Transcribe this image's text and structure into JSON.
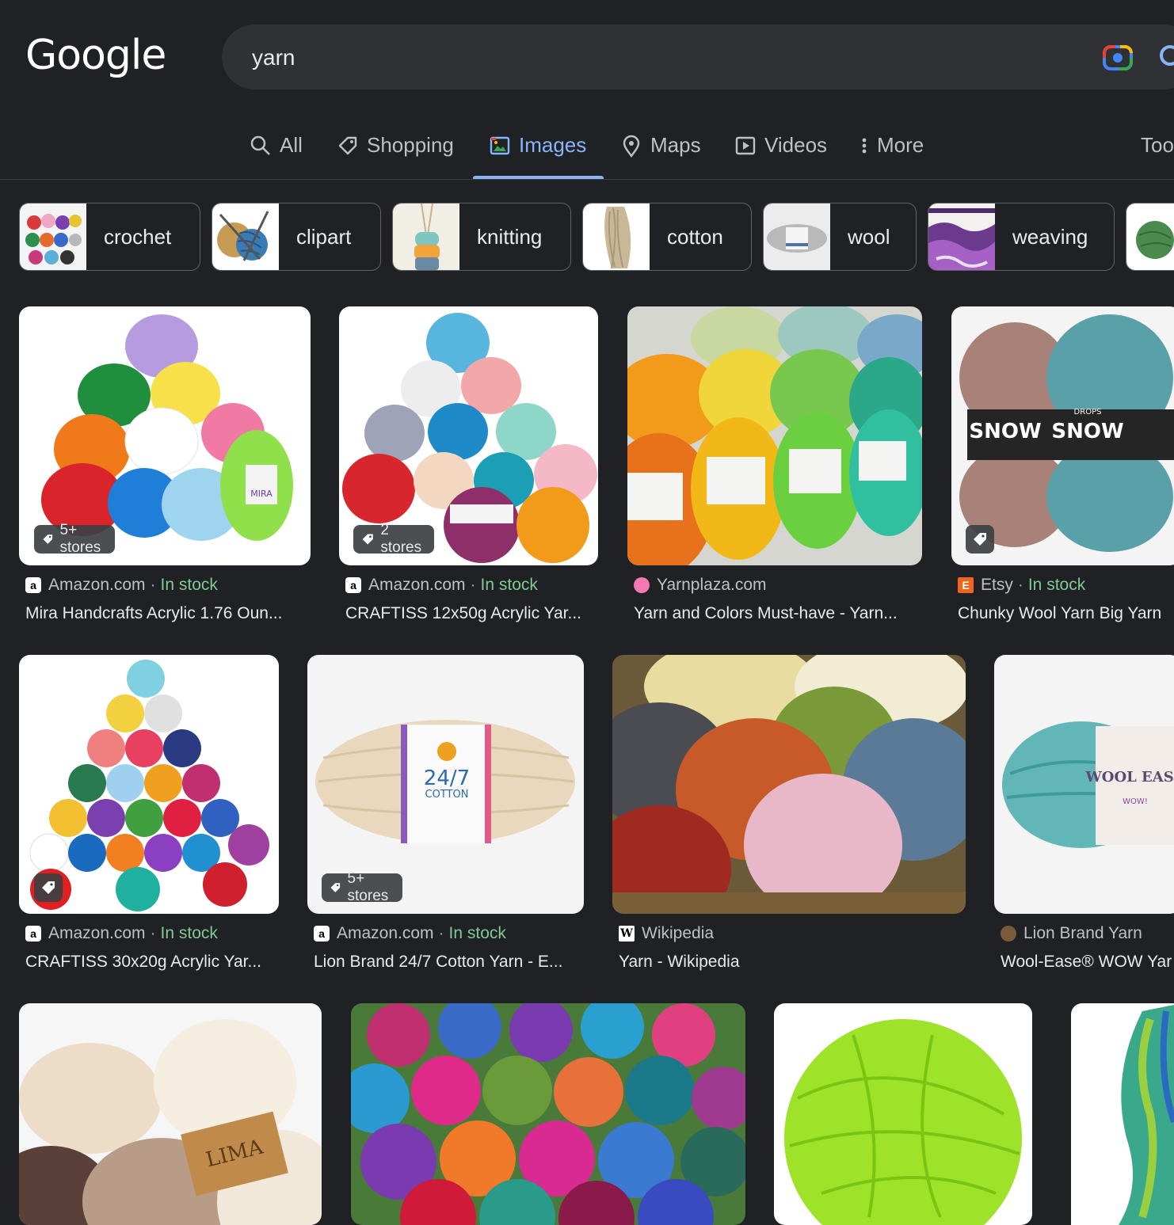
{
  "header": {
    "logo": "Google",
    "search_value": "yarn"
  },
  "tabs": {
    "all": "All",
    "shopping": "Shopping",
    "images": "Images",
    "maps": "Maps",
    "videos": "Videos",
    "more": "More",
    "tools": "Too"
  },
  "chips": [
    "crochet",
    "clipart",
    "knitting",
    "cotton",
    "wool",
    "weaving"
  ],
  "results": [
    {
      "source": "Amazon.com",
      "stock": "In stock",
      "title": "Mira Handcrafts Acrylic 1.76 Oun...",
      "badge": "5+ stores"
    },
    {
      "source": "Amazon.com",
      "stock": "In stock",
      "title": "CRAFTISS 12x50g Acrylic Yar...",
      "badge": "2 stores"
    },
    {
      "source": "Yarnplaza.com",
      "title": "Yarn and Colors Must-have - Yarn..."
    },
    {
      "source": "Etsy",
      "stock": "In stock",
      "title": "Chunky Wool Yarn Big Yarn"
    },
    {
      "source": "Amazon.com",
      "stock": "In stock",
      "title": "CRAFTISS 30x20g Acrylic Yar..."
    },
    {
      "source": "Amazon.com",
      "stock": "In stock",
      "title": "Lion Brand 24/7 Cotton Yarn - E...",
      "badge": "5+ stores"
    },
    {
      "source": "Wikipedia",
      "title": "Yarn - Wikipedia"
    },
    {
      "source": "Lion Brand Yarn",
      "title": "Wool-Ease® WOW Yar"
    }
  ],
  "image_text": {
    "mira": "MIRA",
    "drops_snow": "SNOW",
    "drops": "DROPS",
    "cotton_247": "24/7",
    "cotton_word": "COTTON",
    "wool_ease": "WOOL EASE",
    "wow": "WOW!",
    "lima": "LIMA"
  },
  "colors": {
    "background": "#202124",
    "link_blue": "#8ab4f8",
    "in_stock_green": "#81c995"
  }
}
